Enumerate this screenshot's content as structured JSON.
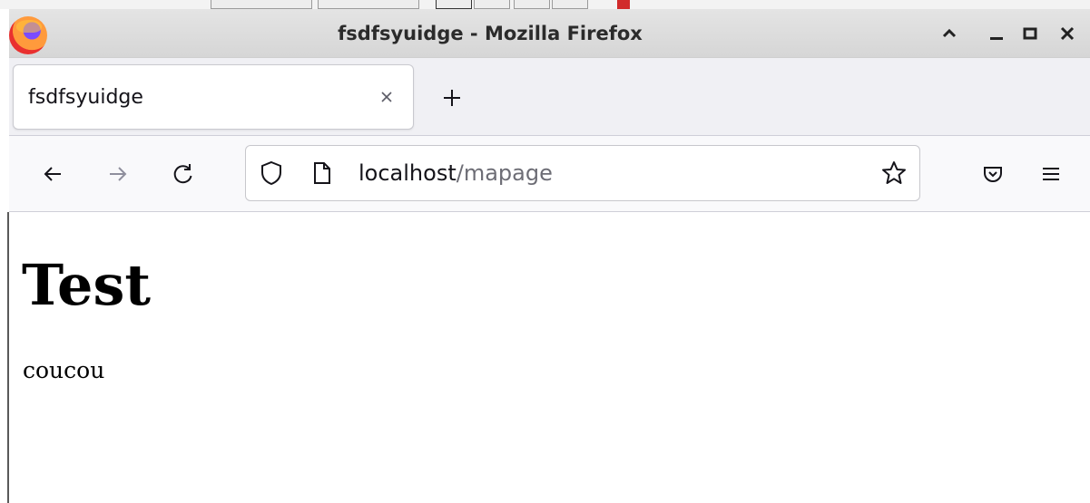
{
  "window": {
    "title": "fsdfsyuidge - Mozilla Firefox"
  },
  "tabs": [
    {
      "title": "fsdfsyuidge",
      "active": true
    }
  ],
  "address_bar": {
    "host": "localhost",
    "path": "/mapage"
  },
  "page": {
    "heading": "Test",
    "paragraph": "coucou"
  },
  "icons": {
    "app": "firefox-logo-icon",
    "window_controls": [
      "chevron-up-icon",
      "minimize-icon",
      "maximize-icon",
      "close-icon"
    ],
    "tab_close": "close-icon",
    "new_tab": "plus-icon",
    "navigation": [
      "back-arrow-icon",
      "forward-arrow-icon",
      "reload-icon"
    ],
    "url_bar": [
      "shield-icon",
      "page-icon",
      "star-icon"
    ],
    "toolbar": [
      "pocket-icon",
      "hamburger-menu-icon"
    ]
  },
  "colors": {
    "titlebar": "#d9d9d9",
    "tabstrip": "#f0f0f4",
    "toolbar": "#f9f9fb",
    "url_host_text": "#15141a",
    "url_path_text": "#6d6d75"
  }
}
